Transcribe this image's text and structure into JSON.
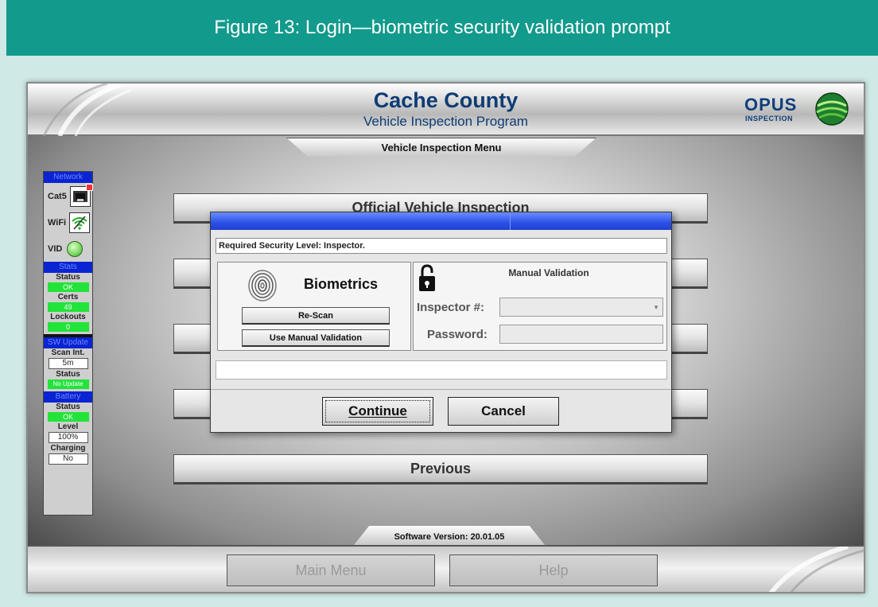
{
  "figure": {
    "caption": "Figure 13: Login—biometric security validation prompt"
  },
  "app": {
    "title": "Cache County",
    "subtitle": "Vehicle Inspection Program",
    "logo": {
      "word": "OPUS",
      "sub": "INSPECTION"
    },
    "menu_tab": "Vehicle Inspection Menu",
    "menu_buttons": [
      "Official Vehicle Inspection",
      "",
      "",
      "",
      "Previous"
    ],
    "software_version": "Software Version: 20.01.05",
    "footer_buttons": {
      "main_menu": "Main Menu",
      "help": "Help"
    }
  },
  "side_panel": {
    "network": {
      "header": "Network",
      "cat5": "Cat5",
      "wifi": "WiFi",
      "vid": "VID"
    },
    "stats": {
      "header": "Stats",
      "status_label": "Status",
      "status_value": "OK",
      "certs_label": "Certs",
      "certs_value": "49",
      "lockouts_label": "Lockouts",
      "lockouts_value": "0"
    },
    "sw_update": {
      "header": "SW Update",
      "scan_label": "Scan Int.",
      "scan_value": "5m",
      "status_label": "Status",
      "status_value": "No Update"
    },
    "battery": {
      "header": "Battery",
      "status_label": "Status",
      "status_value": "OK",
      "level_label": "Level",
      "level_value": "100%",
      "charging_label": "Charging",
      "charging_value": "No"
    },
    "colors": {
      "header_bg": "#0b24d1",
      "ok_green": "#22e33a"
    }
  },
  "dialog": {
    "security_level": "Required Security Level: Inspector.",
    "biometrics": {
      "title": "Biometrics",
      "rescan": "Re-Scan",
      "use_manual": "Use Manual Validation"
    },
    "manual": {
      "title": "Manual Validation",
      "inspector_label": "Inspector #:",
      "inspector_value": "",
      "password_label": "Password:",
      "password_value": ""
    },
    "message": "",
    "continue": "Continue",
    "cancel": "Cancel"
  }
}
